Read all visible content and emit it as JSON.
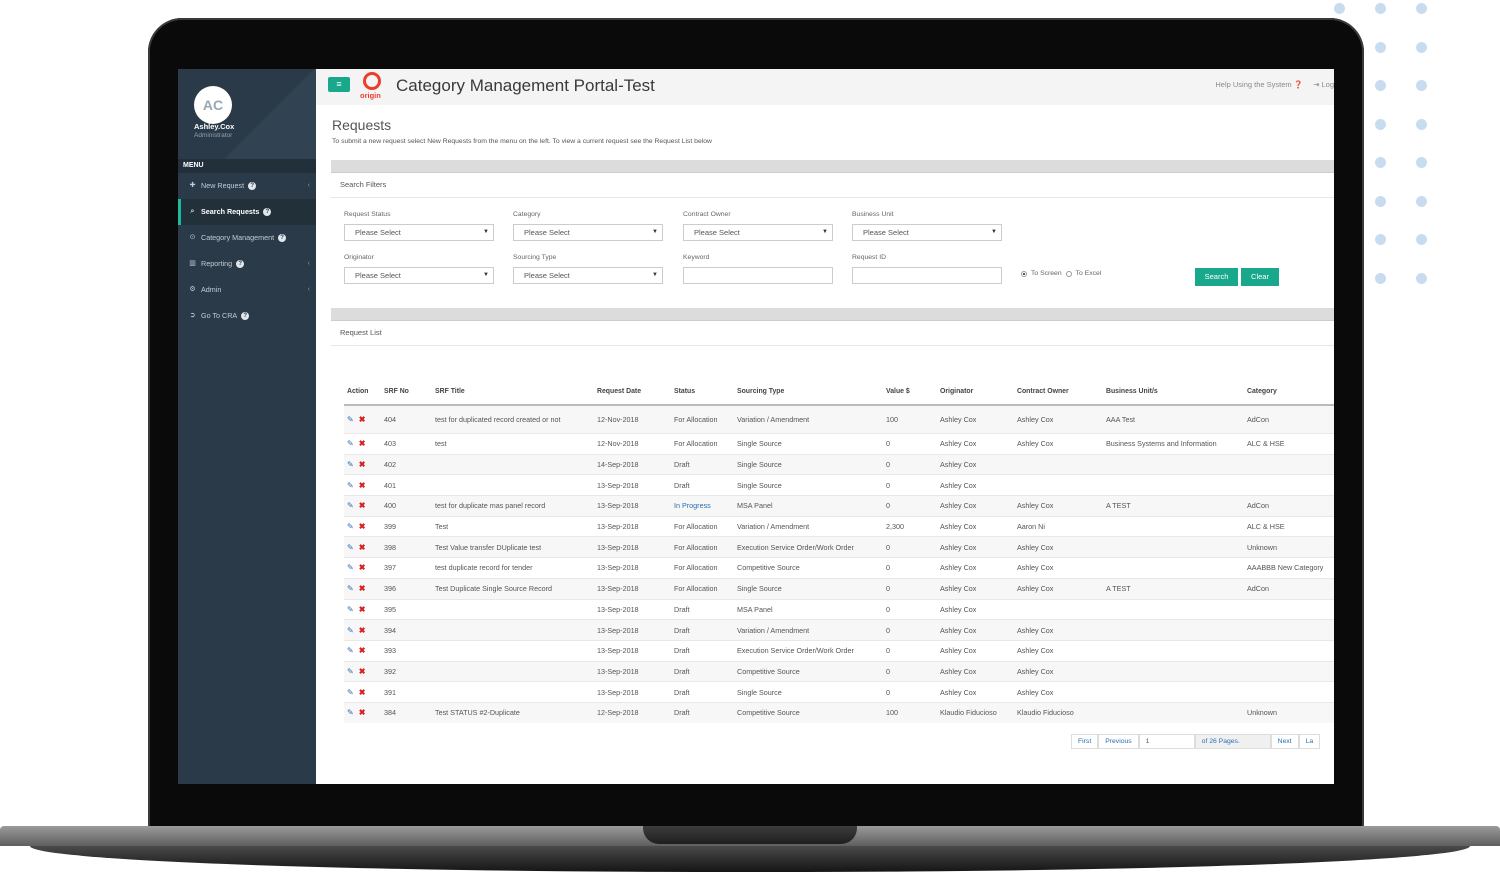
{
  "colors": {
    "accent": "#1aa88c",
    "sidebar": "#2b3a48",
    "logo": "#ee3d2b",
    "link": "#2a6fb0",
    "delete": "#d81e1e"
  },
  "user": {
    "initials": "AC",
    "name": "Ashley.Cox",
    "role": "Administrator"
  },
  "menu": {
    "heading": "MENU",
    "items": [
      {
        "label": "New Request",
        "icon": "plus-icon",
        "has_caret": true
      },
      {
        "label": "Search Requests",
        "icon": "search-icon",
        "active": true
      },
      {
        "label": "Category Management",
        "icon": "circle-icon"
      },
      {
        "label": "Reporting",
        "icon": "bar-chart-icon",
        "has_caret": true
      },
      {
        "label": "Admin",
        "icon": "cogs-icon",
        "has_caret": true
      },
      {
        "label": "Go To CRA",
        "icon": "arrow-circle-icon"
      }
    ]
  },
  "header": {
    "menu_button": "≡",
    "logo_text": "origin",
    "title": "Category Management Portal-Test",
    "help": "Help Using the System",
    "logout": "Log"
  },
  "page": {
    "title": "Requests",
    "subtitle": "To submit a new request select New Requests from the menu on the left. To view a current request see the Request List below"
  },
  "filters": {
    "heading": "Search Filters",
    "request_status": {
      "label": "Request Status",
      "value": "Please Select"
    },
    "category": {
      "label": "Category",
      "value": "Please Select"
    },
    "contract_owner": {
      "label": "Contract Owner",
      "value": "Please Select"
    },
    "business_unit": {
      "label": "Business Unit",
      "value": "Please Select"
    },
    "originator": {
      "label": "Originator",
      "value": "Please Select"
    },
    "sourcing_type": {
      "label": "Sourcing Type",
      "value": "Please Select"
    },
    "keyword": {
      "label": "Keyword",
      "value": ""
    },
    "request_id": {
      "label": "Request ID",
      "value": ""
    },
    "output": {
      "to_screen": "To Screen",
      "to_excel": "To Excel",
      "selected": "To Screen"
    },
    "search_button": "Search",
    "clear_button": "Clear"
  },
  "request_list": {
    "heading": "Request List",
    "columns": [
      "Action",
      "SRF No",
      "SRF Title",
      "Request Date",
      "Status",
      "Sourcing Type",
      "Value $",
      "Originator",
      "Contract Owner",
      "Business Unit/s",
      "Category"
    ],
    "rows": [
      {
        "no": "404",
        "title": "test for duplicated record created or not",
        "date": "12-Nov-2018",
        "status": "For Allocation",
        "sourcing": "Variation / Amendment",
        "value": "100",
        "originator": "Ashley Cox",
        "owner": "Ashley Cox",
        "bu": "AAA Test",
        "category": "AdCon"
      },
      {
        "no": "403",
        "title": "test",
        "date": "12-Nov-2018",
        "status": "For Allocation",
        "sourcing": "Single Source",
        "value": "0",
        "originator": "Ashley Cox",
        "owner": "Ashley Cox",
        "bu": "Business Systems and Information",
        "category": "ALC & HSE"
      },
      {
        "no": "402",
        "title": "",
        "date": "14-Sep-2018",
        "status": "Draft",
        "sourcing": "Single Source",
        "value": "0",
        "originator": "Ashley Cox",
        "owner": "",
        "bu": "",
        "category": ""
      },
      {
        "no": "401",
        "title": "",
        "date": "13-Sep-2018",
        "status": "Draft",
        "sourcing": "Single Source",
        "value": "0",
        "originator": "Ashley Cox",
        "owner": "",
        "bu": "",
        "category": ""
      },
      {
        "no": "400",
        "title": "test for duplicate mas panel record",
        "date": "13-Sep-2018",
        "status": "In Progress",
        "sourcing": "MSA Panel",
        "value": "0",
        "originator": "Ashley Cox",
        "owner": "Ashley Cox",
        "bu": "A TEST",
        "category": "AdCon"
      },
      {
        "no": "399",
        "title": "Test",
        "date": "13-Sep-2018",
        "status": "For Allocation",
        "sourcing": "Variation / Amendment",
        "value": "2,300",
        "originator": "Ashley Cox",
        "owner": "Aaron Ni",
        "bu": "",
        "category": "ALC & HSE"
      },
      {
        "no": "398",
        "title": "Test Value transfer DUplicate test",
        "date": "13-Sep-2018",
        "status": "For Allocation",
        "sourcing": "Execution Service Order/Work Order",
        "value": "0",
        "originator": "Ashley Cox",
        "owner": "Ashley Cox",
        "bu": "",
        "category": "Unknown"
      },
      {
        "no": "397",
        "title": "test duplicate record for tender",
        "date": "13-Sep-2018",
        "status": "For Allocation",
        "sourcing": "Competitive Source",
        "value": "0",
        "originator": "Ashley Cox",
        "owner": "Ashley Cox",
        "bu": "",
        "category": "AAABBB New Category"
      },
      {
        "no": "396",
        "title": "Test Duplicate Single Source Record",
        "date": "13-Sep-2018",
        "status": "For Allocation",
        "sourcing": "Single Source",
        "value": "0",
        "originator": "Ashley Cox",
        "owner": "Ashley Cox",
        "bu": "A TEST",
        "category": "AdCon"
      },
      {
        "no": "395",
        "title": "",
        "date": "13-Sep-2018",
        "status": "Draft",
        "sourcing": "MSA Panel",
        "value": "0",
        "originator": "Ashley Cox",
        "owner": "",
        "bu": "",
        "category": ""
      },
      {
        "no": "394",
        "title": "",
        "date": "13-Sep-2018",
        "status": "Draft",
        "sourcing": "Variation / Amendment",
        "value": "0",
        "originator": "Ashley Cox",
        "owner": "Ashley Cox",
        "bu": "",
        "category": ""
      },
      {
        "no": "393",
        "title": "",
        "date": "13-Sep-2018",
        "status": "Draft",
        "sourcing": "Execution Service Order/Work Order",
        "value": "0",
        "originator": "Ashley Cox",
        "owner": "Ashley Cox",
        "bu": "",
        "category": ""
      },
      {
        "no": "392",
        "title": "",
        "date": "13-Sep-2018",
        "status": "Draft",
        "sourcing": "Competitive Source",
        "value": "0",
        "originator": "Ashley Cox",
        "owner": "Ashley Cox",
        "bu": "",
        "category": ""
      },
      {
        "no": "391",
        "title": "",
        "date": "13-Sep-2018",
        "status": "Draft",
        "sourcing": "Single Source",
        "value": "0",
        "originator": "Ashley Cox",
        "owner": "Ashley Cox",
        "bu": "",
        "category": ""
      },
      {
        "no": "384",
        "title": "Test STATUS #2-Duplicate",
        "date": "12-Sep-2018",
        "status": "Draft",
        "sourcing": "Competitive Source",
        "value": "100",
        "originator": "Klaudio Fiducioso",
        "owner": "Klaudio Fiducioso",
        "bu": "",
        "category": "Unknown"
      }
    ]
  },
  "pager": {
    "first": "First",
    "previous": "Previous",
    "page": "1",
    "of_pages": "of 26 Pages.",
    "next": "Next",
    "last": "La"
  }
}
